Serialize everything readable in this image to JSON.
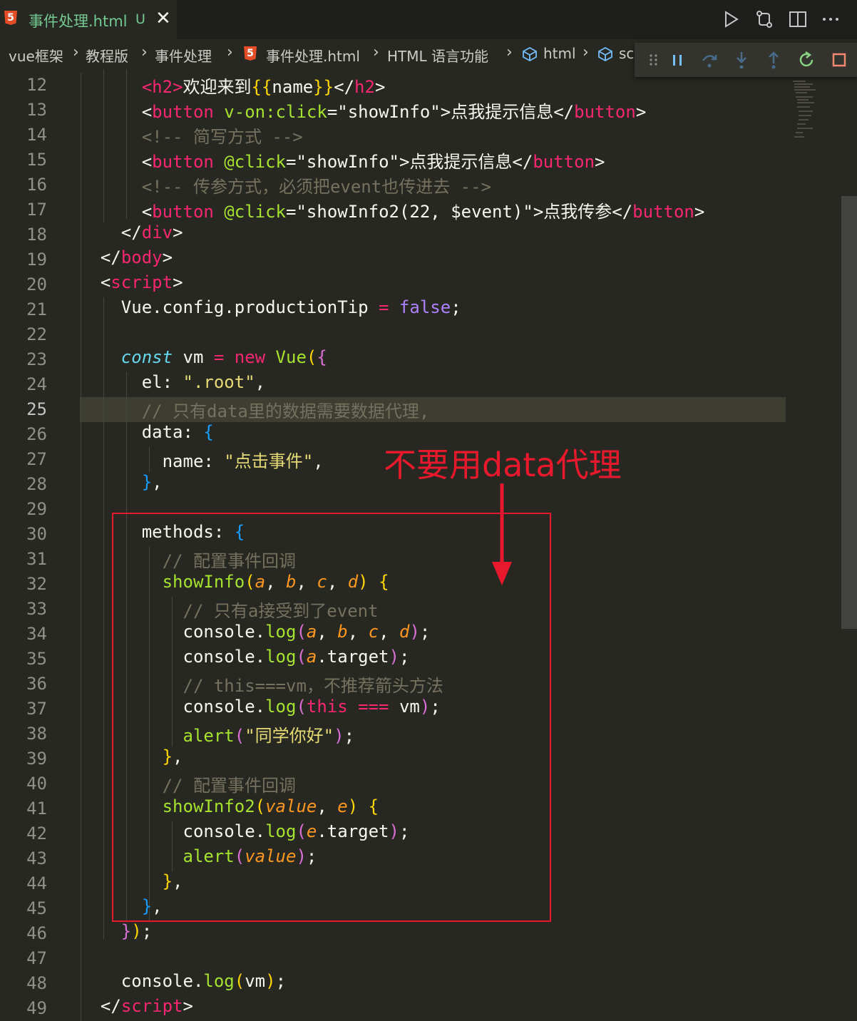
{
  "tab": {
    "title": "事件处理.html",
    "status": "U",
    "icon": "html5-icon"
  },
  "top_actions": [
    "run-icon",
    "compare-changes-icon",
    "split-editor-icon",
    "more-icon"
  ],
  "breadcrumb": {
    "items": [
      "vue框架",
      "教程版",
      "事件处理",
      "事件处理.html",
      "HTML 语言功能",
      "html",
      "sc"
    ]
  },
  "debug_toolbar": [
    "drag-handle-icon",
    "pause-icon",
    "step-over-icon",
    "step-into-icon",
    "step-out-icon",
    "restart-icon",
    "stop-icon"
  ],
  "line_numbers": [
    "12",
    "13",
    "14",
    "15",
    "16",
    "17",
    "18",
    "19",
    "20",
    "21",
    "22",
    "23",
    "24",
    "25",
    "26",
    "27",
    "28",
    "29",
    "30",
    "31",
    "32",
    "33",
    "34",
    "35",
    "36",
    "37",
    "38",
    "39",
    "40",
    "41",
    "42",
    "43",
    "44",
    "45",
    "46",
    "47",
    "48",
    "49"
  ],
  "code": {
    "l12": {
      "open": "<",
      "tag": "h2",
      "close": ">",
      "text": "欢迎来到",
      "mus1": "{{",
      "var": "name",
      "mus2": "}}",
      "etag_open": "</",
      "etag": "h2",
      "etag_close": ">"
    },
    "l13": {
      "open": "<",
      "tag": "button",
      "attr": " v-on:click",
      "eq": "=",
      "val": "\"showInfo\"",
      "close": ">",
      "text": "点我提示信息",
      "etag_open": "</",
      "etag": "button",
      "etag_close": ">"
    },
    "l14": "<!-- 简写方式 -->",
    "l15": {
      "open": "<",
      "tag": "button",
      "attr": " @click",
      "eq": "=",
      "val": "\"showInfo\"",
      "close": ">",
      "text": "点我提示信息",
      "etag_open": "</",
      "etag": "button",
      "etag_close": ">"
    },
    "l16": "<!-- 传参方式，必须把event也传进去 -->",
    "l17": {
      "open": "<",
      "tag": "button",
      "attr": " @click",
      "eq": "=",
      "val": "\"showInfo2(22, $event)\"",
      "close": ">",
      "text": "点我传参",
      "etag_open": "</",
      "etag": "button",
      "etag_close": ">"
    },
    "l18": {
      "open": "</",
      "tag": "div",
      "close": ">"
    },
    "l19": {
      "open": "</",
      "tag": "body",
      "close": ">"
    },
    "l20": {
      "open": "<",
      "tag": "script",
      "close": ">"
    },
    "l21": {
      "a": "Vue.config.productionTip ",
      "op": "=",
      "val": " false",
      "end": ";"
    },
    "l23": {
      "kw": "const",
      "name": " vm ",
      "op": "=",
      "nw": " new",
      "cls": " Vue",
      "p": "(",
      "b": "{"
    },
    "l24": {
      "key": "el: ",
      "val": "\".root\"",
      "end": ","
    },
    "l25": "// 只有data里的数据需要数据代理,",
    "l26": {
      "key": "data: ",
      "b": "{"
    },
    "l27": {
      "key": "name: ",
      "val": "\"点击事件\"",
      "end": ","
    },
    "l28": {
      "b": "}",
      "end": ","
    },
    "l30": {
      "key": "methods: ",
      "b": "{"
    },
    "l31": "// 配置事件回调",
    "l32": {
      "fn": "showInfo",
      "p1": "(",
      "a": "a",
      "c1": ", ",
      "b": "b",
      "c2": ", ",
      "c": "c",
      "c3": ", ",
      "d": "d",
      "p2": ")",
      "sp": " ",
      "br": "{"
    },
    "l33": "// 只有a接受到了event",
    "l34": {
      "obj": "console.",
      "fn": "log",
      "p1": "(",
      "a": "a",
      "c1": ", ",
      "b": "b",
      "c2": ", ",
      "c": "c",
      "c3": ", ",
      "d": "d",
      "p2": ")",
      "end": ";"
    },
    "l35": {
      "obj": "console.",
      "fn": "log",
      "p1": "(",
      "a": "a",
      "prop": ".target",
      "p2": ")",
      "end": ";"
    },
    "l36": "// this===vm，不推荐箭头方法",
    "l37": {
      "obj": "console.",
      "fn": "log",
      "p1": "(",
      "th": "this",
      "op": " === ",
      "vm": "vm",
      "p2": ")",
      "end": ";"
    },
    "l38": {
      "fn": "alert",
      "p1": "(",
      "val": "\"同学你好\"",
      "p2": ")",
      "end": ";"
    },
    "l39": {
      "b": "}",
      "end": ","
    },
    "l40": "// 配置事件回调",
    "l41": {
      "fn": "showInfo2",
      "p1": "(",
      "v": "value",
      "c1": ", ",
      "e": "e",
      "p2": ")",
      "sp": " ",
      "br": "{"
    },
    "l42": {
      "obj": "console.",
      "fn": "log",
      "p1": "(",
      "e": "e",
      "prop": ".target",
      "p2": ")",
      "end": ";"
    },
    "l43": {
      "fn": "alert",
      "p1": "(",
      "v": "value",
      "p2": ")",
      "end": ";"
    },
    "l44": {
      "b": "}",
      "end": ","
    },
    "l45": {
      "b": "}",
      "end": ","
    },
    "l46": {
      "b": "}",
      "p": ")",
      "end": ";"
    },
    "l48": {
      "obj": "console.",
      "fn": "log",
      "p1": "(",
      "vm": "vm",
      "p2": ")",
      "end": ";"
    },
    "l49": {
      "open": "</",
      "tag": "script",
      "close": ">"
    }
  },
  "annotation": {
    "text": "不要用data代理",
    "color": "#e8192c"
  },
  "colors": {
    "background": "#272822",
    "tag": "#f92672",
    "attr": "#a6e22e",
    "string": "#e6db74",
    "comment": "#75715e",
    "keyword": "#66d9ef",
    "param": "#fd971f",
    "number": "#ae81ff"
  }
}
